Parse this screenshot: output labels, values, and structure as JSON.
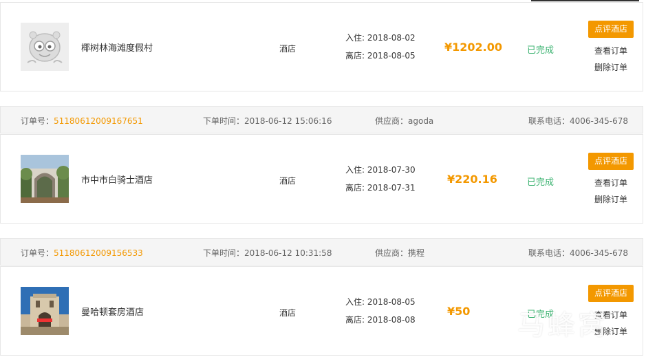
{
  "orders": [
    {
      "header": null,
      "hotel_name": "椰树林海滩度假村",
      "type": "酒店",
      "checkin": "入住: 2018-08-02",
      "checkout": "离店: 2018-08-05",
      "price": "¥1202.00",
      "status": "已完成",
      "review_label": "点评酒店",
      "view_label": "查看订单",
      "delete_label": "删除订单",
      "thumb_icon": "placeholder-mascot-icon"
    },
    {
      "header": {
        "order_no_label": "订单号：",
        "order_no": "51180612009167651",
        "order_time": "下单时间：2018-06-12 15:06:16",
        "supplier": "供应商：agoda",
        "phone": "联系电话：4006-345-678"
      },
      "hotel_name": "市中市白骑士酒店",
      "type": "酒店",
      "checkin": "入住: 2018-07-30",
      "checkout": "离店: 2018-07-31",
      "price": "¥220.16",
      "status": "已完成",
      "review_label": "点评酒店",
      "view_label": "查看订单",
      "delete_label": "删除订单",
      "thumb_icon": "hotel-garden-photo"
    },
    {
      "header": {
        "order_no_label": "订单号：",
        "order_no": "51180612009156533",
        "order_time": "下单时间：2018-06-12 10:31:58",
        "supplier": "供应商：携程",
        "phone": "联系电话：4006-345-678"
      },
      "hotel_name": "曼哈顿套房酒店",
      "type": "酒店",
      "checkin": "入住: 2018-08-05",
      "checkout": "离店: 2018-08-08",
      "price": "¥50",
      "status": "已完成",
      "review_label": "点评酒店",
      "view_label": "查看订单",
      "delete_label": "删除订单",
      "thumb_icon": "hotel-building-photo"
    }
  ],
  "watermark": "马蜂窝",
  "colors": {
    "accent": "#f39800",
    "status_done": "#3cb371",
    "header_bg": "#f5f5f5"
  }
}
